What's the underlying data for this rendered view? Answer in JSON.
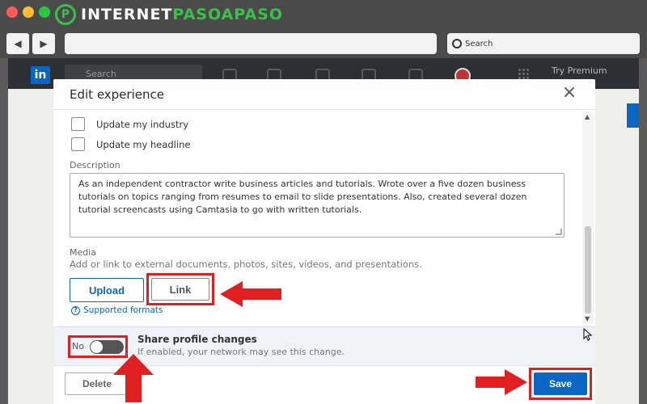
{
  "browser": {
    "logo_mark": "P",
    "logo_part1": "INTERNET",
    "logo_part2": "PASOAPASO",
    "search_placeholder": "Search"
  },
  "linkedin": {
    "logo": "in",
    "search": "Search",
    "premium": "Try Premium"
  },
  "modal": {
    "title": "Edit experience",
    "close_glyph": "×",
    "checkboxes": [
      {
        "label": "Update my industry",
        "checked": false
      },
      {
        "label": "Update my headline",
        "checked": false
      }
    ],
    "description_label": "Description",
    "description": "As an independent contractor write business articles and tutorials. Wrote over a five dozen business tutorials on topics ranging from resumes to email to slide presentations. Also, created several dozen tutorial screencasts using Camtasia to go with written tutorials.",
    "media_label": "Media",
    "media_help": "Add or link to external documents, photos, sites, videos, and presentations.",
    "upload_label": "Upload",
    "link_label": "Link",
    "supported_formats": "Supported formats",
    "share": {
      "toggle_value": "No",
      "title": "Share profile changes",
      "subtitle": "If enabled, your network may see this change."
    },
    "delete_label": "Delete",
    "save_label": "Save"
  },
  "colors": {
    "accent": "#0a66c2",
    "highlight": "#e02020"
  }
}
